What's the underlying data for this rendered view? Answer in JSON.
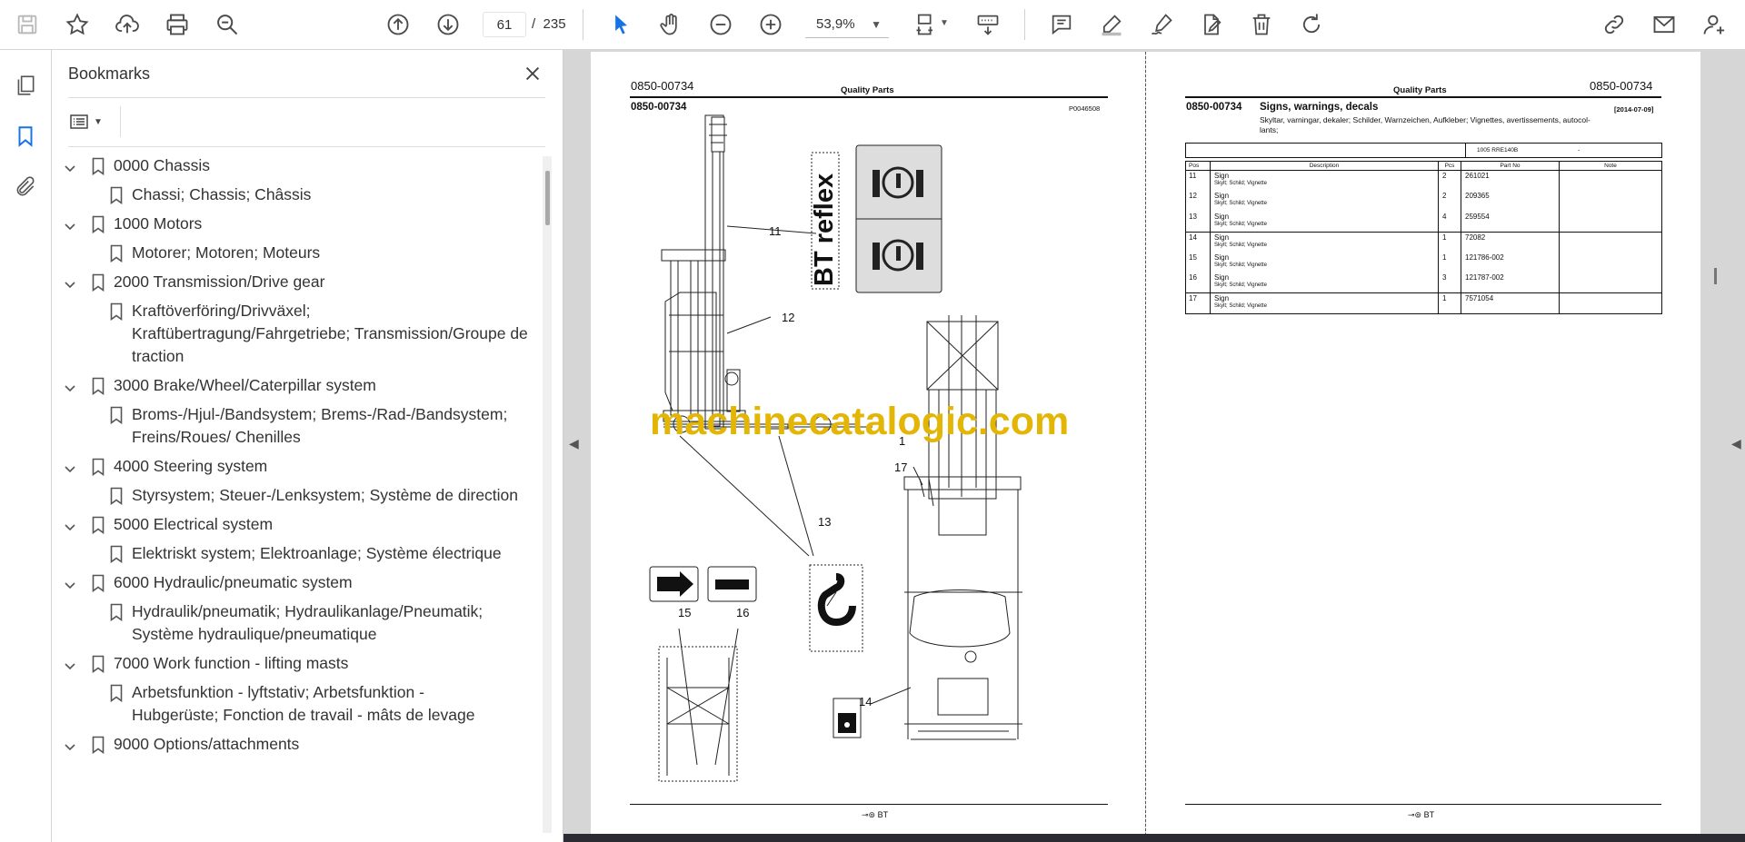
{
  "toolbar": {
    "page_current": "61",
    "page_separator": "/",
    "page_total": "235",
    "zoom": "53,9%",
    "icons": [
      "save-icon",
      "star-icon",
      "upload-icon",
      "print-icon",
      "zoom-search-icon",
      "page-up-icon",
      "page-down-icon",
      "select-cursor-icon",
      "hand-icon",
      "zoom-out-icon",
      "zoom-in-icon",
      "fit-page-icon",
      "scroll-mode-icon",
      "comment-icon",
      "highlight-icon",
      "sign-icon",
      "edit-pdf-icon",
      "delete-icon",
      "rotate-icon",
      "share-link-icon",
      "email-icon",
      "account-icon"
    ]
  },
  "panel": {
    "title": "Bookmarks",
    "items": [
      {
        "label": "0000 Chassis",
        "level": 0
      },
      {
        "label": "Chassi; Chassis; Châssis",
        "level": 1
      },
      {
        "label": "1000 Motors",
        "level": 0
      },
      {
        "label": "Motorer; Motoren; Moteurs",
        "level": 1
      },
      {
        "label": "2000 Transmission/Drive gear",
        "level": 0
      },
      {
        "label": "Kraftöverföring/Drivväxel;",
        "label2": "Kraftübertragung/Fahrgetriebe; Transmission/Groupe de",
        "label3": "traction",
        "level": 1
      },
      {
        "label": "3000 Brake/Wheel/Caterpillar system",
        "level": 0
      },
      {
        "label": "Broms-/Hjul-/Bandsystem; Brems-/Rad-/Bandsystem;",
        "label2": "Freins/Roues/ Chenilles",
        "level": 1
      },
      {
        "label": "4000 Steering system",
        "level": 0
      },
      {
        "label": "Styrsystem; Steuer-/Lenksystem; Système de direction",
        "level": 1
      },
      {
        "label": "5000 Electrical system",
        "level": 0
      },
      {
        "label": "Elektriskt system; Elektroanlage; Système électrique",
        "level": 1
      },
      {
        "label": "6000 Hydraulic/pneumatic system",
        "level": 0
      },
      {
        "label": "Hydraulik/pneumatik; Hydraulikanlage/Pneumatik;",
        "label2": "Système hydraulique/pneumatique",
        "level": 1
      },
      {
        "label": "7000 Work function - lifting masts",
        "level": 0
      },
      {
        "label": "Arbetsfunktion - lyftstativ; Arbetsfunktion -",
        "label2": "Hubgerüste; Fonction de travail - mâts de levage",
        "level": 1
      },
      {
        "label": "9000 Options/attachments",
        "level": 0
      }
    ]
  },
  "left_page": {
    "top_left_code": "0850-00734",
    "header_title": "Quality Parts",
    "sub_code": "0850-00734",
    "fig_code": "P0046508",
    "callouts": [
      "11",
      "12",
      "13",
      "14",
      "15",
      "16",
      "17",
      "1"
    ],
    "decal_text": "BT reflex",
    "footer": "BT"
  },
  "right_page": {
    "header_title": "Quality Parts",
    "top_right_code": "0850-00734",
    "section_code": "0850-00734",
    "section_title": "Signs, warnings, decals",
    "date": "[2014-07-09]",
    "subtitle": "Skyltar, varningar, dekaler; Schilder, Warnzeichen, Aufkleber; Vignettes, avertissements, autocol-",
    "subtitle2": "lants;",
    "model_row": {
      "model": "1005  RRE140B",
      "range": "-"
    },
    "columns": [
      "Pos",
      "Description",
      "Pcs",
      "Part No",
      "Note"
    ],
    "rows": [
      {
        "pos": "11",
        "desc": "Sign",
        "sub": "Skylt; Schild; Vignette",
        "pcs": "2",
        "part": "261021"
      },
      {
        "pos": "12",
        "desc": "Sign",
        "sub": "Skylt; Schild; Vignette",
        "pcs": "2",
        "part": "209365"
      },
      {
        "pos": "13",
        "desc": "Sign",
        "sub": "Skylt; Schild; Vignette",
        "pcs": "4",
        "part": "259554"
      },
      {
        "pos": "14",
        "desc": "Sign",
        "sub": "Skylt; Schild; Vignette",
        "pcs": "1",
        "part": "72082"
      },
      {
        "pos": "15",
        "desc": "Sign",
        "sub": "Skylt; Schild; Vignette",
        "pcs": "1",
        "part": "121786-002"
      },
      {
        "pos": "16",
        "desc": "Sign",
        "sub": "Skylt; Schild; Vignette",
        "pcs": "3",
        "part": "121787-002"
      },
      {
        "pos": "17",
        "desc": "Sign",
        "sub": "Skylt; Schild; Vignette",
        "pcs": "1",
        "part": "7571054"
      }
    ],
    "footer": "BT"
  },
  "watermark": "machinecatalogic.com",
  "colors": {
    "accent": "#1473e6",
    "watermark": "#e3b505"
  }
}
